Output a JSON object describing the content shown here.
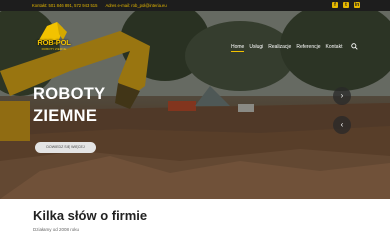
{
  "topbar": {
    "contact": "Kontakt: 501 846 891, 572 943 515",
    "email": "Adres e-mail: rob_pol@interia.eu",
    "social_icons": [
      "facebook-icon",
      "twitter-icon",
      "linkedin-icon"
    ]
  },
  "logo": {
    "name": "ROB-POL",
    "tagline": "ROBOTY ZIEMNE"
  },
  "nav": {
    "items": [
      "Home",
      "Usługi",
      "Realizacje",
      "Referencje",
      "Kontakt"
    ],
    "active": "Home"
  },
  "hero": {
    "title_line1": "ROBOTY",
    "title_line2": "ZIEMNE",
    "button": "DOWIEDZ SIĘ WIĘCEJ",
    "next_arrow": "›",
    "prev_arrow": "‹"
  },
  "about": {
    "title": "Kilka słów o firmie",
    "subtitle": "Działamy od 2008 roku"
  },
  "colors": {
    "accent": "#f2c200",
    "topbar_bg": "#1d1d1d"
  }
}
